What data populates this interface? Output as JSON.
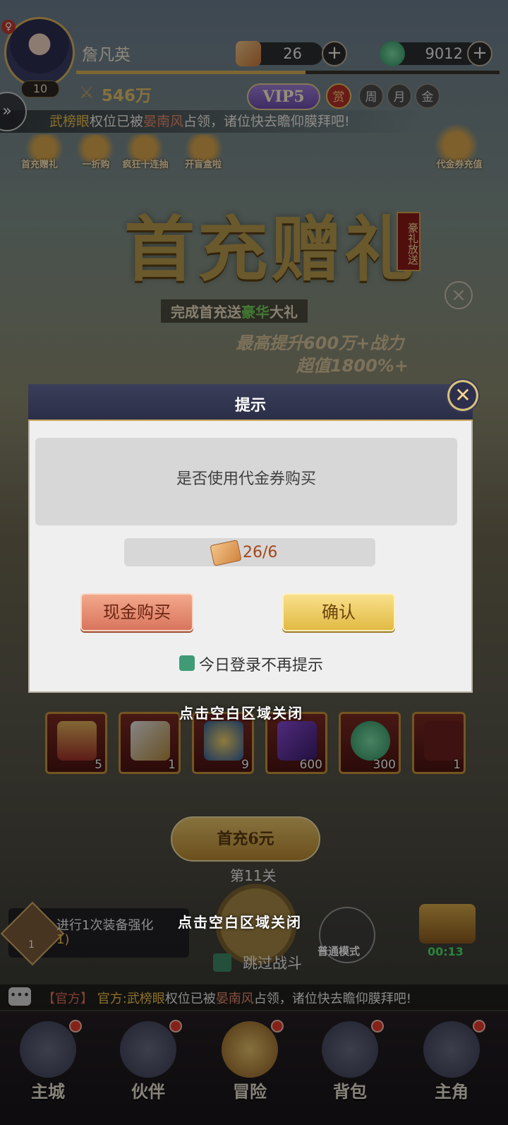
{
  "player": {
    "name": "詹凡英",
    "level": "10",
    "power": "546万",
    "vip": "VIP5"
  },
  "resources": [
    {
      "icon": "coupon-icon",
      "value": "26"
    },
    {
      "icon": "jade-icon",
      "value": "9012"
    }
  ],
  "cards": [
    "赏",
    "周",
    "月",
    "金"
  ],
  "marquee_top": {
    "name1": "武榜眼",
    "t1": "权位已被",
    "name2": "晏南风",
    "t2": "占领，诸位快去瞻仰膜拜吧!"
  },
  "top_icons": [
    {
      "label": "首充赠礼"
    },
    {
      "label": "一折购"
    },
    {
      "label": "疯狂十连抽"
    },
    {
      "label": "开盲盒啦"
    },
    {
      "label": "代金券充值"
    }
  ],
  "banner": {
    "title": "首充赠礼",
    "stamp": "豪礼放送",
    "sub_a": "完成首充送",
    "sub_b": "豪华",
    "sub_c": "大礼",
    "line1": "最高提升600万+战力",
    "line2": "超值1800%+"
  },
  "dialog": {
    "title": "提示",
    "message": "是否使用代金券购买",
    "cost": "26/6",
    "cash_button": "现金购买",
    "confirm_button": "确认",
    "checkbox_label": "今日登录不再提示"
  },
  "close_hint": "点击空白区域关闭",
  "rewards": [
    {
      "icon": "chest-icon",
      "count": "5"
    },
    {
      "icon": "sword-icon",
      "count": "1"
    },
    {
      "icon": "orb-icon",
      "count": "9"
    },
    {
      "icon": "book-icon",
      "count": "600"
    },
    {
      "icon": "jade-icon",
      "count": "300"
    },
    {
      "icon": "item-icon",
      "count": "1"
    }
  ],
  "first_pay_button": "首充6元",
  "stage": "第11关",
  "task": {
    "text": "进行1次装备强化",
    "progress": "1)",
    "icon_count": "1"
  },
  "skip_label": "跳过战斗",
  "mode_label": "普通模式",
  "chest_timer": "00:13",
  "chat": {
    "tag": "【官方】",
    "prefix": "官方:",
    "name1": "武榜眼",
    "t1": "权位已被",
    "name2": "晏南风",
    "t2": "占领，诸位快去瞻仰膜拜吧!"
  },
  "nav": [
    {
      "label": "主城"
    },
    {
      "label": "伙伴"
    },
    {
      "label": "冒险"
    },
    {
      "label": "背包"
    },
    {
      "label": "主角"
    }
  ]
}
